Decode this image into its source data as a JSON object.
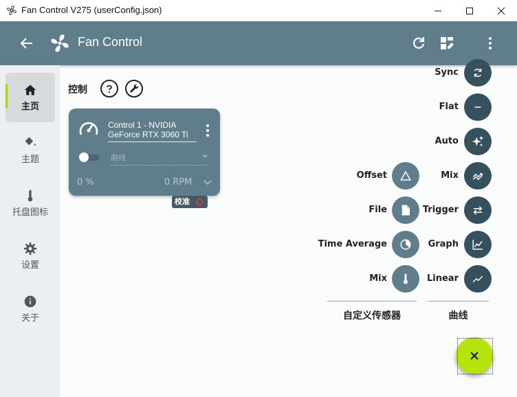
{
  "window": {
    "title": "Fan Control V275 (userConfig.json)"
  },
  "appbar": {
    "title": "Fan Control"
  },
  "sidebar": {
    "items": [
      {
        "label": "主页",
        "icon": "home-icon",
        "active": true
      },
      {
        "label": "主题",
        "icon": "paint-bucket-icon",
        "active": false
      },
      {
        "label": "托盘图标",
        "icon": "thermometer-icon",
        "active": false
      },
      {
        "label": "设置",
        "icon": "gear-icon",
        "active": false
      },
      {
        "label": "关于",
        "icon": "info-icon",
        "active": false
      }
    ]
  },
  "main": {
    "section_title": "控制",
    "control_card": {
      "name_line1": "Control 1 - NVIDIA",
      "name_line2": "GeForce RTX 3060 Ti",
      "curve_value": "曲线",
      "percent": "0 %",
      "rpm": "0 RPM",
      "calibrate_label": "校准"
    }
  },
  "fab_menu": {
    "curve_buttons": [
      {
        "label": "Sync",
        "icon": "sync-icon"
      },
      {
        "label": "Flat",
        "icon": "minus-icon"
      },
      {
        "label": "Auto",
        "icon": "sparkle-icon"
      },
      {
        "label": "Mix",
        "icon": "mix-icon"
      },
      {
        "label": "Trigger",
        "icon": "swap-icon"
      },
      {
        "label": "Graph",
        "icon": "graph-icon"
      },
      {
        "label": "Linear",
        "icon": "linear-icon"
      }
    ],
    "sensor_buttons": [
      {
        "label": "Offset",
        "icon": "triangle-icon"
      },
      {
        "label": "File",
        "icon": "file-icon"
      },
      {
        "label": "Time Average",
        "icon": "time-average-icon"
      },
      {
        "label": "Mix",
        "icon": "thermometer-icon"
      }
    ],
    "sensor_group_label": "自定义传感器",
    "curve_group_label": "曲线"
  },
  "colors": {
    "primary": "#607d8b",
    "primary_dark": "#37505e",
    "accent": "#b4e40a",
    "sidebar_bg": "#eceff1"
  }
}
